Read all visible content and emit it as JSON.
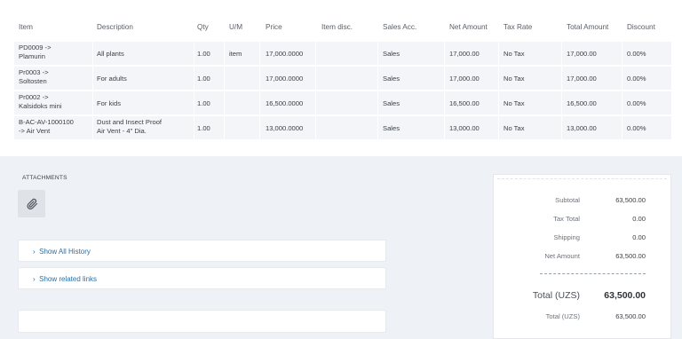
{
  "items_table": {
    "headers": {
      "item": "Item",
      "description": "Description",
      "qty": "Qty",
      "um": "U/M",
      "price": "Price",
      "item_disc": "Item disc.",
      "sales_acc": "Sales Acc.",
      "net_amount": "Net Amount",
      "tax_rate": "Tax Rate",
      "total_amount": "Total Amount",
      "discount": "Discount"
    },
    "rows": [
      {
        "item_line1": "PD0009 ->",
        "item_line2": "Plamurin",
        "desc_line1": "All plants",
        "desc_line2": "",
        "qty": "1.00",
        "um": "item",
        "price": "17,000.0000",
        "item_disc": "",
        "sales_acc": "Sales",
        "net_amount": "17,000.00",
        "tax_rate": "No Tax",
        "total_amount": "17,000.00",
        "discount": "0.00%"
      },
      {
        "item_line1": "Pr0003 ->",
        "item_line2": "Soltosten",
        "desc_line1": "For adults",
        "desc_line2": "",
        "qty": "1.00",
        "um": "",
        "price": "17,000.0000",
        "item_disc": "",
        "sales_acc": "Sales",
        "net_amount": "17,000.00",
        "tax_rate": "No Tax",
        "total_amount": "17,000.00",
        "discount": "0.00%"
      },
      {
        "item_line1": "Pr0002 ->",
        "item_line2": "Kalsidoks mini",
        "desc_line1": "For kids",
        "desc_line2": "",
        "qty": "1.00",
        "um": "",
        "price": "16,500.0000",
        "item_disc": "",
        "sales_acc": "Sales",
        "net_amount": "16,500.00",
        "tax_rate": "No Tax",
        "total_amount": "16,500.00",
        "discount": "0.00%"
      },
      {
        "item_line1": "B-AC-AV-1000100",
        "item_line2": "-> Air Vent",
        "desc_line1": "Dust and Insect Proof",
        "desc_line2": "Air Vent - 4\" Dia.",
        "qty": "1.00",
        "um": "",
        "price": "13,000.0000",
        "item_disc": "",
        "sales_acc": "Sales",
        "net_amount": "13,000.00",
        "tax_rate": "No Tax",
        "total_amount": "13,000.00",
        "discount": "0.00%"
      }
    ]
  },
  "attachments": {
    "label": "ATTACHMENTS",
    "icon": "paperclip-icon"
  },
  "links": {
    "show_history": "Show All History",
    "show_related": "Show related links"
  },
  "totals": {
    "subtotal_label": "Subtotal",
    "subtotal_value": "63,500.00",
    "tax_total_label": "Tax Total",
    "tax_total_value": "0.00",
    "shipping_label": "Shipping",
    "shipping_value": "0.00",
    "net_amount_label": "Net Amount",
    "net_amount_value": "63,500.00",
    "total_label": "Total (UZS)",
    "total_value": "63,500.00",
    "total_small_label": "Total (UZS)",
    "total_small_value": "63,500.00"
  },
  "colors": {
    "link": "#2d6fa3",
    "row_bg": "#f3f5f8",
    "page_bg": "#eef1f5"
  }
}
